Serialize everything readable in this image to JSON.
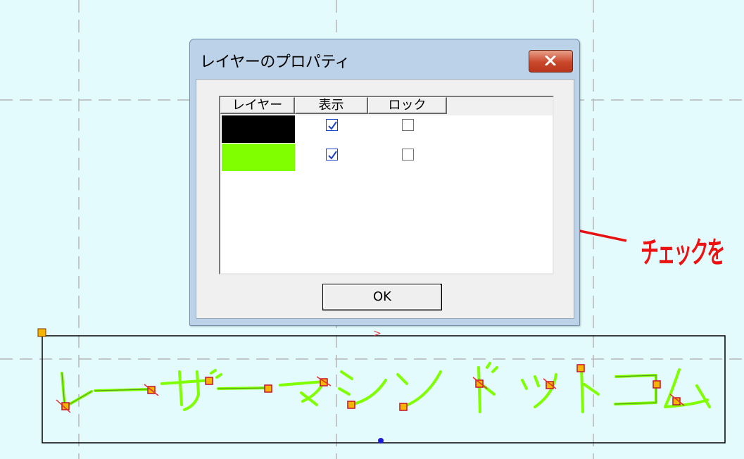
{
  "dialog": {
    "title": "レイヤーのプロパティ",
    "close_icon": "close-icon",
    "columns": [
      "レイヤー",
      "表示",
      "ロック"
    ],
    "rows": [
      {
        "color": "#000000",
        "visible": true,
        "locked": false
      },
      {
        "color": "#7fff00",
        "visible": true,
        "locked": false
      }
    ],
    "ok_label": "OK"
  },
  "annotation": {
    "text": "チェックを",
    "color": "#ee1111"
  },
  "canvas": {
    "background": "#e3fbfd",
    "text_art": "レーザーマシンドットコム",
    "stroke_color": "#7fff00",
    "node_color": "#e8c800"
  }
}
